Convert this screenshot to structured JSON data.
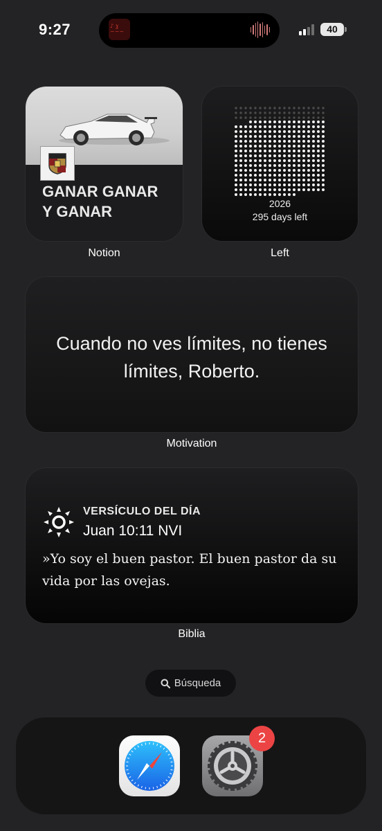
{
  "status_bar": {
    "time": "9:27",
    "battery": "40"
  },
  "widgets": {
    "notion": {
      "text": " GANAR GANAR\nY GANAR",
      "label": "Notion"
    },
    "left": {
      "year": "2026",
      "days_left": "295 days left",
      "label": "Left"
    },
    "motivation": {
      "quote": "Cuando no ves límites, no tienes límites, Roberto.",
      "label": "Motivation"
    },
    "biblia": {
      "heading": "VERSÍCULO DEL DÍA",
      "reference": "Juan 10:11 NVI",
      "verse": "»Yo soy el buen pastor. El buen pastor da su vida por las ovejas.",
      "label": "Biblia"
    }
  },
  "search": {
    "label": "Búsqueda"
  },
  "dock": {
    "apps": [
      {
        "name": "Safari",
        "icon": "safari-icon"
      },
      {
        "name": "Ajustes",
        "icon": "settings-icon",
        "badge": "2"
      }
    ]
  },
  "colors": {
    "background": "#232325",
    "badge": "#ec4444",
    "safari_blue": "#1e8cf0"
  }
}
